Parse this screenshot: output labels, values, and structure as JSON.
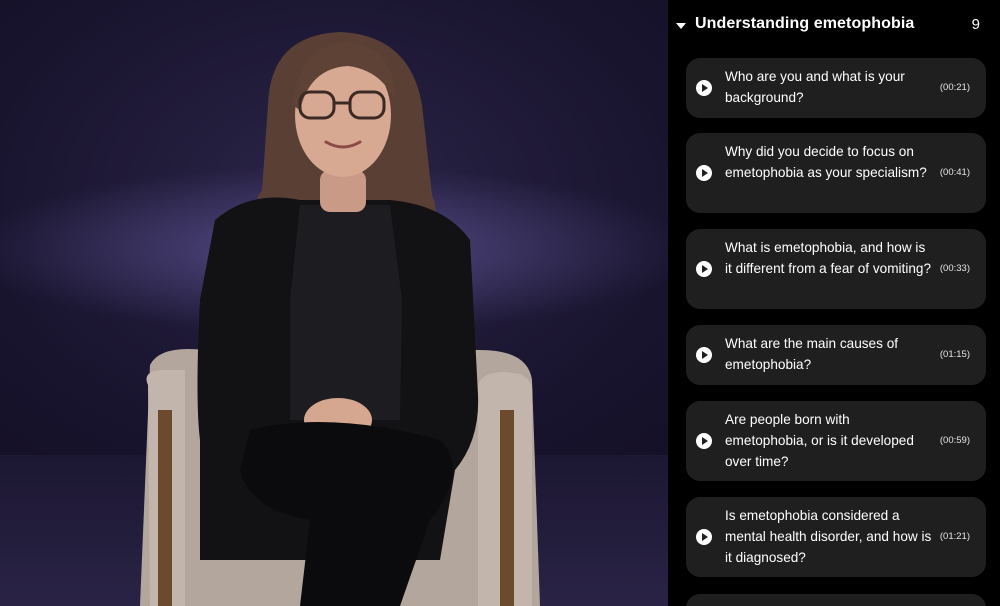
{
  "playlist": {
    "section_title": "Understanding emetophobia",
    "section_count": "9",
    "items": [
      {
        "question": "Who are you and what is your background?",
        "duration": "(00:21)"
      },
      {
        "question": "Why did you decide to focus on emetophobia as your specialism?",
        "duration": "(00:41)"
      },
      {
        "question": "What is emetophobia, and how is it different from a fear of vomiting?",
        "duration": "(00:33)"
      },
      {
        "question": "What are the main causes of emetophobia?",
        "duration": "(01:15)"
      },
      {
        "question": "Are people born with emetophobia, or is it developed over time?",
        "duration": "(00:59)"
      },
      {
        "question": "Is emetophobia considered a mental health disorder, and how is it diagnosed?",
        "duration": "(01:21)"
      }
    ]
  },
  "icons": {
    "section_toggle": "caret-down-icon",
    "play": "play-circle-icon"
  },
  "colors": {
    "panel_bg": "#000000",
    "item_bg": "#1f1f1f",
    "text": "#ffffff"
  }
}
